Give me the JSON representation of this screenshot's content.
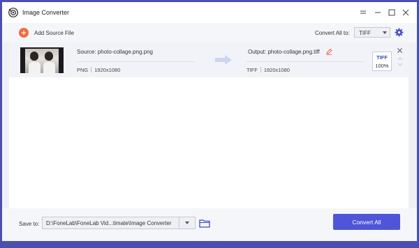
{
  "window": {
    "title": "Image Converter"
  },
  "toolbar": {
    "add_source_label": "Add Source File",
    "convert_all_to_label": "Convert All to:",
    "convert_all_format": "TIFF"
  },
  "file_item": {
    "source_name": "Source: photo-collage.png.png",
    "source_format": "PNG",
    "source_resolution": "1920x1080",
    "output_name": "Output: photo-collage.png.tiff",
    "output_format": "TIFF",
    "output_resolution": "1920x1080",
    "badge_format": "TIFF",
    "badge_quality": "100%"
  },
  "footer": {
    "save_to_label": "Save to:",
    "save_path": "D:\\FoneLab\\FoneLab Vid...timate\\Image Converter",
    "convert_all_button": "Convert All"
  },
  "colors": {
    "frame": "#4a4fb0",
    "accent": "#4f55d6",
    "add_icon": "#f26d3d",
    "badge_text": "#2a4dbf"
  },
  "icons": {
    "app": "app-logo-icon",
    "add": "plus-circle-icon",
    "settings": "gear-icon",
    "arrow": "arrow-right-icon",
    "edit": "pencil-icon",
    "close": "close-icon",
    "folder": "folder-icon"
  }
}
